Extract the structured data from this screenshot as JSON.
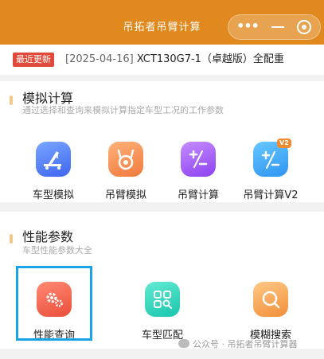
{
  "nav": {
    "title": "吊拓者吊臂计算",
    "more": "•••"
  },
  "notice": {
    "badge": "最近更新",
    "date": "[2025-04-16]",
    "text": " XCT130G7-1（卓越版）全配重"
  },
  "sim": {
    "title": "模拟计算",
    "subtitle": "通过选择和查询来模拟计算指定车型工况的工作参数",
    "items": [
      {
        "label": "车型模拟",
        "icon": "crane-icon",
        "color": "#4f7df5"
      },
      {
        "label": "吊臂模拟",
        "icon": "hook-icon",
        "color": "#f5894e"
      },
      {
        "label": "吊臂计算",
        "icon": "calculator-icon",
        "color": "#9b57f2"
      },
      {
        "label": "吊臂计算V2",
        "icon": "calculator-v2-icon",
        "color": "#3aa3f3",
        "badge": "V2"
      }
    ]
  },
  "perf": {
    "title": "性能参数",
    "subtitle": "车型性能参数大全",
    "items": [
      {
        "label": "性能查询",
        "icon": "gears-icon",
        "color": "#f0604a"
      },
      {
        "label": "车型匹配",
        "icon": "grid-search-icon",
        "color": "#22cdb4"
      },
      {
        "label": "模糊搜索",
        "icon": "magnifier-icon",
        "color": "#f5a04a"
      }
    ]
  },
  "watermark": "公众号 · 吊拓者吊臂计算器"
}
